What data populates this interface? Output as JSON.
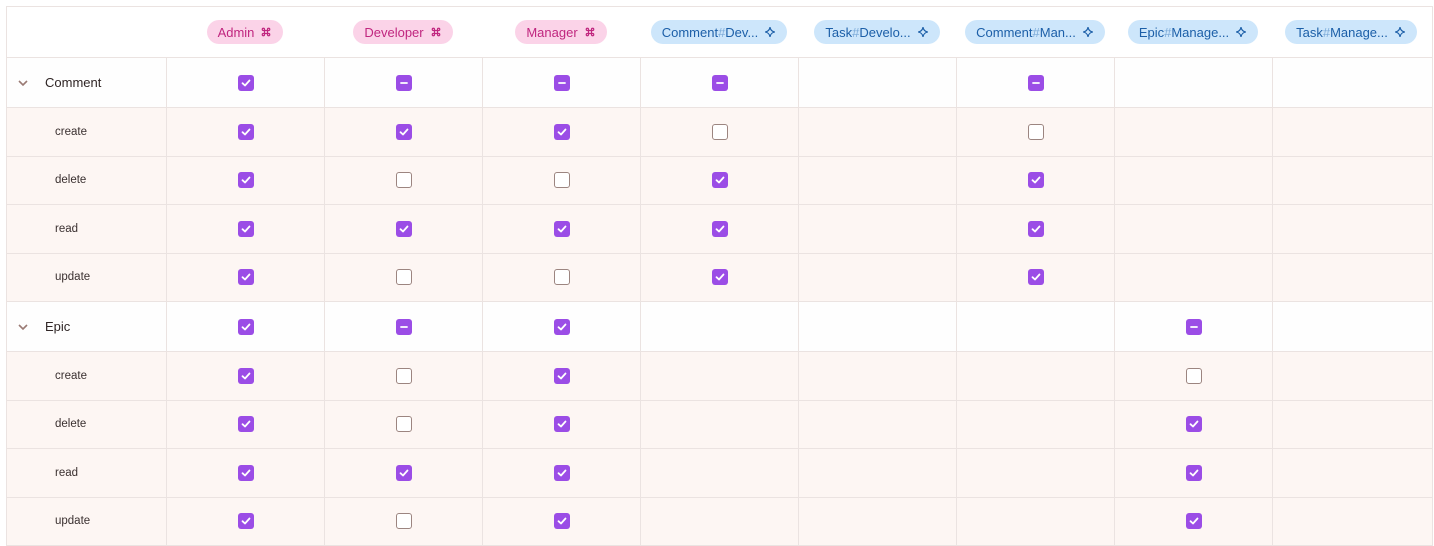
{
  "columns": [
    {
      "label": "Admin",
      "kind": "role",
      "icon": "command-icon"
    },
    {
      "label": "Developer",
      "kind": "role",
      "icon": "command-icon"
    },
    {
      "label": "Manager",
      "kind": "role",
      "icon": "command-icon"
    },
    {
      "prefix": "Comment",
      "suffix": "Dev...",
      "kind": "relation",
      "icon": "sparkle-icon"
    },
    {
      "prefix": "Task",
      "suffix": "Develo...",
      "kind": "relation",
      "icon": "sparkle-icon"
    },
    {
      "prefix": "Comment",
      "suffix": "Man...",
      "kind": "relation",
      "icon": "sparkle-icon"
    },
    {
      "prefix": "Epic",
      "suffix": "Manage...",
      "kind": "relation",
      "icon": "sparkle-icon"
    },
    {
      "prefix": "Task",
      "suffix": "Manage...",
      "kind": "relation",
      "icon": "sparkle-icon"
    }
  ],
  "groups": [
    {
      "name": "Comment",
      "expanded": true,
      "summary": [
        "checked",
        "mixed",
        "mixed",
        "mixed",
        "",
        "mixed",
        "",
        ""
      ],
      "permissions": [
        {
          "name": "create",
          "cells": [
            "checked",
            "checked",
            "checked",
            "unchecked",
            "",
            "unchecked",
            "",
            ""
          ]
        },
        {
          "name": "delete",
          "cells": [
            "checked",
            "unchecked",
            "unchecked",
            "checked",
            "",
            "checked",
            "",
            ""
          ]
        },
        {
          "name": "read",
          "cells": [
            "checked",
            "checked",
            "checked",
            "checked",
            "",
            "checked",
            "",
            ""
          ]
        },
        {
          "name": "update",
          "cells": [
            "checked",
            "unchecked",
            "unchecked",
            "checked",
            "",
            "checked",
            "",
            ""
          ]
        }
      ]
    },
    {
      "name": "Epic",
      "expanded": true,
      "summary": [
        "checked",
        "mixed",
        "checked",
        "",
        "",
        "",
        "mixed",
        ""
      ],
      "permissions": [
        {
          "name": "create",
          "cells": [
            "checked",
            "unchecked",
            "checked",
            "",
            "",
            "",
            "unchecked",
            ""
          ]
        },
        {
          "name": "delete",
          "cells": [
            "checked",
            "unchecked",
            "checked",
            "",
            "",
            "",
            "checked",
            ""
          ]
        },
        {
          "name": "read",
          "cells": [
            "checked",
            "checked",
            "checked",
            "",
            "",
            "",
            "checked",
            ""
          ]
        },
        {
          "name": "update",
          "cells": [
            "checked",
            "unchecked",
            "checked",
            "",
            "",
            "",
            "checked",
            ""
          ]
        }
      ]
    }
  ],
  "colors": {
    "checkbox_accent": "#9b4de6",
    "role_pill_bg": "#fbd3e8",
    "relation_pill_bg": "#cde6fb",
    "permission_row_bg": "#fdf6f3"
  }
}
